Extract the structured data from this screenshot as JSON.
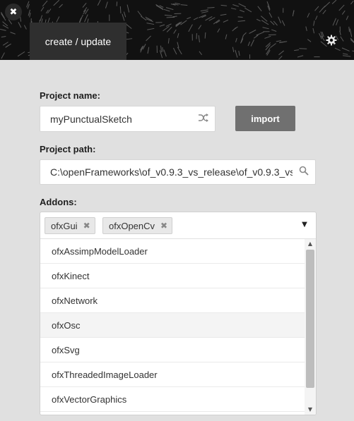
{
  "window": {
    "close_icon": "✖",
    "tab_label": "create / update",
    "settings_icon": "gear-icon"
  },
  "form": {
    "project_name_label": "Project name:",
    "project_name_value": "myPunctualSketch",
    "shuffle_icon": "shuffle-icon",
    "import_label": "import",
    "project_path_label": "Project path:",
    "project_path_value": "C:\\openFrameworks\\of_v0.9.3_vs_release\\of_v0.9.3_vs_",
    "search_icon": "search-icon",
    "addons_label": "Addons:"
  },
  "addons": {
    "selected": [
      {
        "label": "ofxGui",
        "remove": "✖"
      },
      {
        "label": "ofxOpenCv",
        "remove": "✖"
      }
    ],
    "options": [
      "ofxAssimpModelLoader",
      "ofxKinect",
      "ofxNetwork",
      "ofxOsc",
      "ofxSvg",
      "ofxThreadedImageLoader",
      "ofxVectorGraphics"
    ],
    "hovered_option": "ofxOsc"
  },
  "colors": {
    "header_bg": "#111111",
    "tab_bg": "#2f2f2f",
    "body_bg": "#e0e0e0",
    "import_bg": "#707070"
  }
}
